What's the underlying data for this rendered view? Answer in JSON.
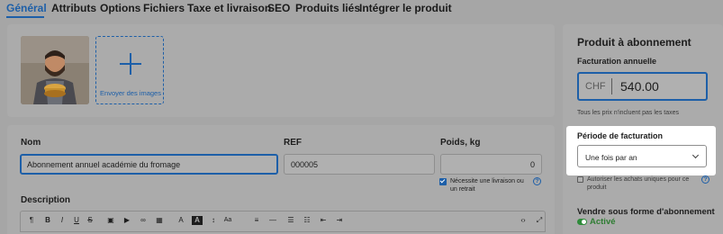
{
  "tabs": [
    {
      "label": "Général"
    },
    {
      "label": "Attributs"
    },
    {
      "label": "Options"
    },
    {
      "label": "Fichiers"
    },
    {
      "label": "Taxe et livraison"
    },
    {
      "label": "SEO"
    },
    {
      "label": "Produits liés"
    },
    {
      "label": "Intégrer le produit"
    }
  ],
  "active_tab": "Général",
  "images": {
    "upload_label": "Envoyer des images"
  },
  "details": {
    "name_label": "Nom",
    "name_value": "Abonnement annuel académie du fromage",
    "ref_label": "REF",
    "ref_value": "000005",
    "weight_label": "Poids, kg",
    "weight_value": "0",
    "shipping_check_label": "Nécessite une livraison ou un retrait",
    "shipping_checked": true,
    "description_label": "Description"
  },
  "subscription": {
    "title": "Produit à abonnement",
    "billing_label": "Facturation annuelle",
    "currency": "CHF",
    "price": "540.00",
    "tax_note": "Tous les prix n'incluent pas les taxes",
    "period_label": "Période de facturation",
    "period_value": "Une fois par an",
    "one_time_label": "Autoriser les achats uniques pour ce produit",
    "one_time_checked": false,
    "sell_label": "Vendre sous forme d'abonnement",
    "status": "Activé"
  },
  "icons": {
    "help": "?",
    "status_color": "#2e7d32",
    "accent": "#1d5fa8"
  }
}
